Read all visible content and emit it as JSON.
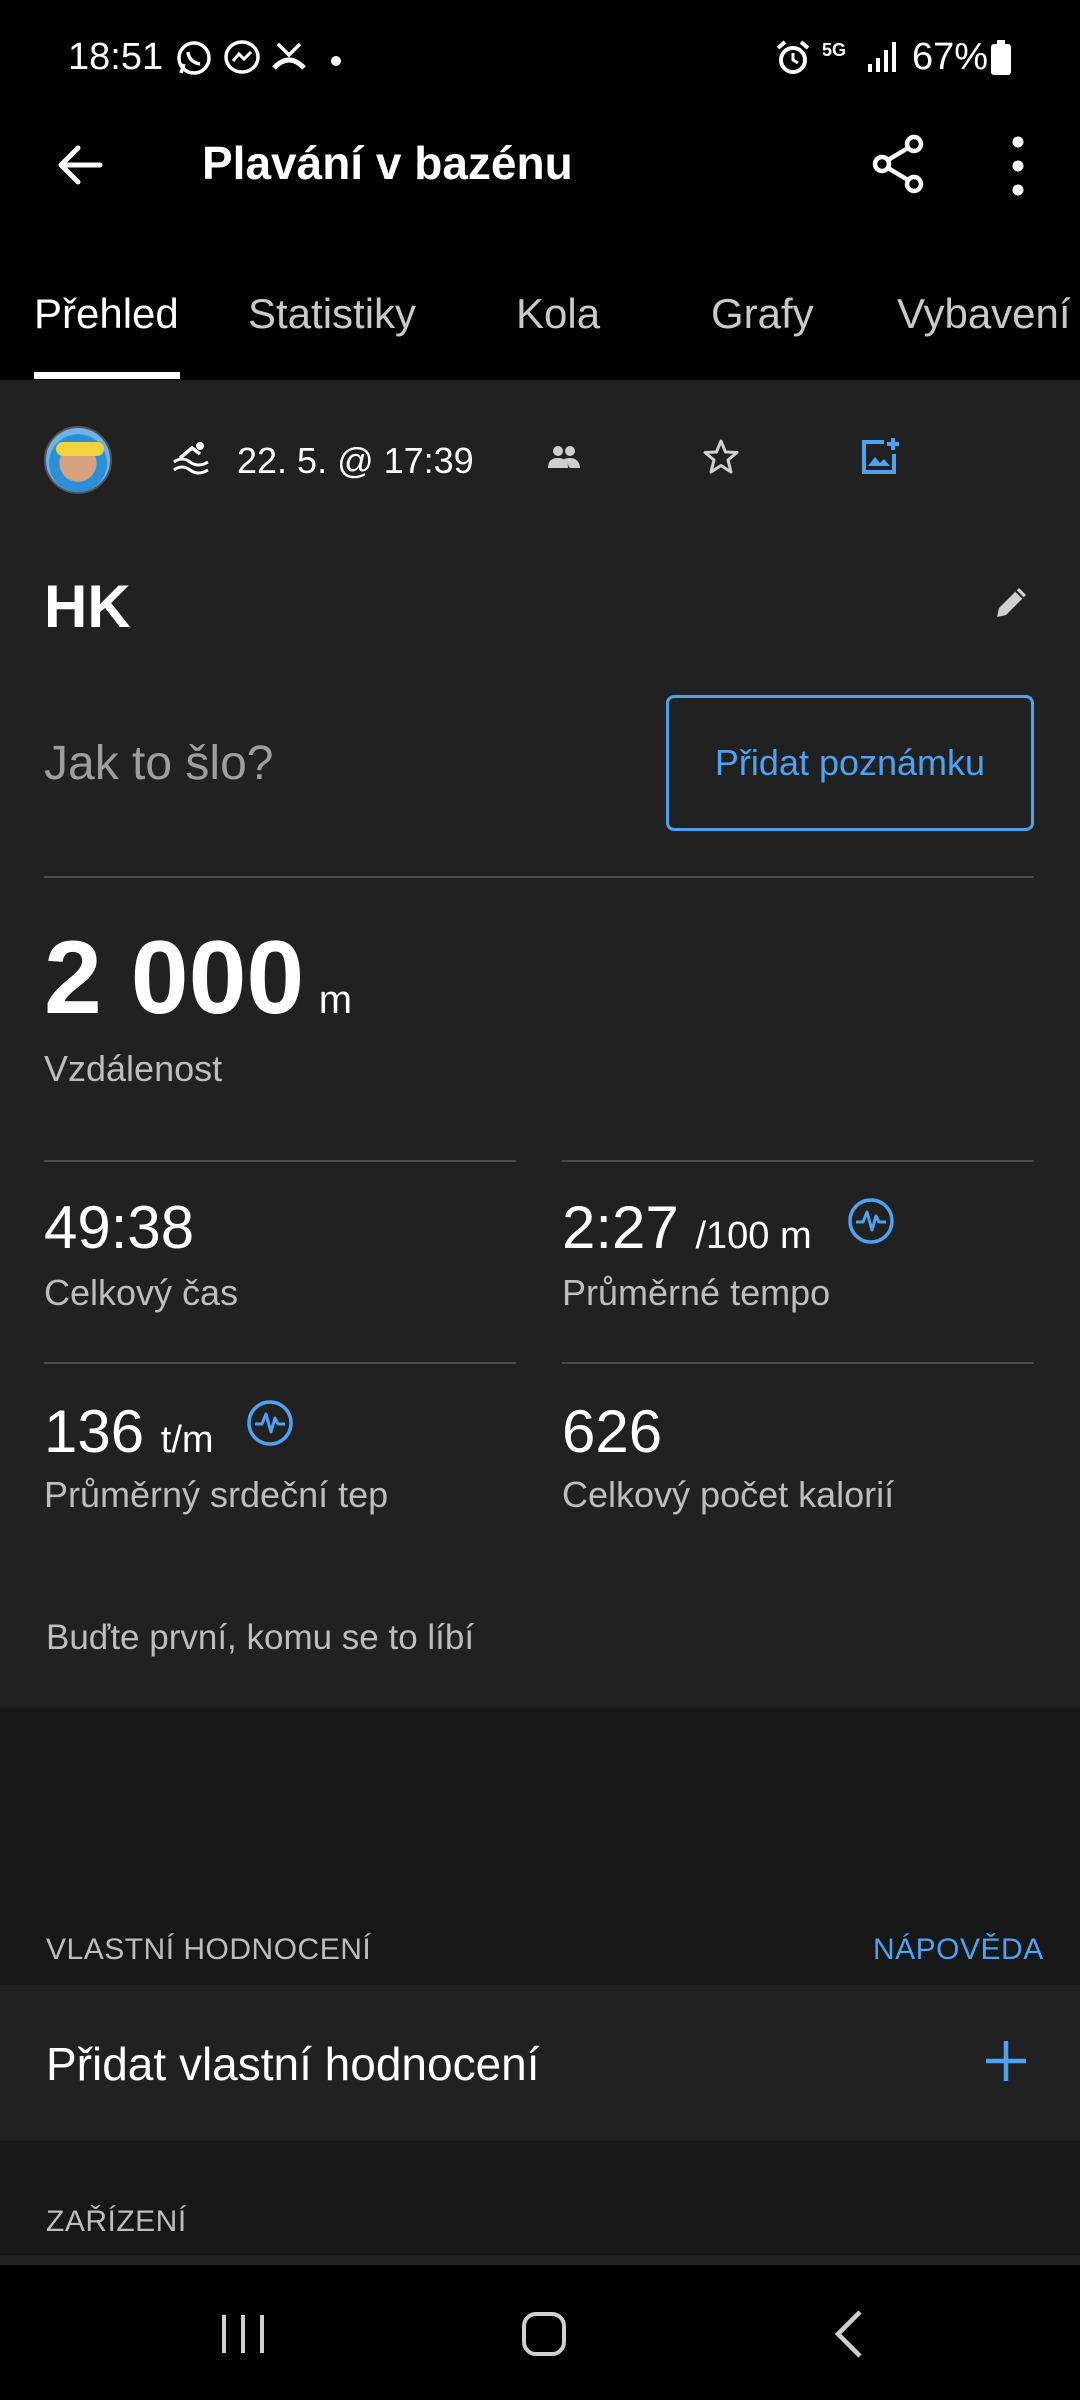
{
  "status_bar": {
    "time": "18:51",
    "battery": "67%",
    "network": "5G",
    "icons": [
      "whatsapp-icon",
      "messenger-icon",
      "missed-call-icon",
      "dot-icon",
      "alarm-icon",
      "signal-icon",
      "battery-icon"
    ]
  },
  "app_bar": {
    "title": "Plavání v bazénu",
    "icons": [
      "back-arrow-icon",
      "share-icon",
      "more-vert-icon"
    ]
  },
  "tabs": [
    {
      "label": "Přehled",
      "active": true
    },
    {
      "label": "Statistiky",
      "active": false
    },
    {
      "label": "Kola",
      "active": false
    },
    {
      "label": "Grafy",
      "active": false
    },
    {
      "label": "Vybavení",
      "active": false
    }
  ],
  "activity": {
    "date": "22. 5. @ 17:39",
    "name": "HK",
    "note_prompt": "Jak to šlo?",
    "add_note_label": "Přidat poznámku"
  },
  "distance": {
    "value": "2 000",
    "unit": "m",
    "label": "Vzdálenost"
  },
  "stats": [
    {
      "value": "49:38",
      "unit": "",
      "label": "Celkový čas"
    },
    {
      "value": "2:27",
      "unit": "/100 m",
      "label": "Průměrné tempo"
    },
    {
      "value": "136",
      "unit": "t/m",
      "label": "Průměrný srdeční tep"
    },
    {
      "value": "626",
      "unit": "",
      "label": "Celkový počet kalorií"
    }
  ],
  "likes_text": "Buďte první, komu se to líbí",
  "custom_rating": {
    "header": "VLASTNÍ HODNOCENÍ",
    "help_label": "NÁPOVĚDA",
    "add_label": "Přidat vlastní hodnocení"
  },
  "device": {
    "header": "ZAŘÍZENÍ"
  },
  "colors": {
    "accent": "#4aa3f5",
    "background": "#000000",
    "card": "#212121",
    "secondary_text": "#bdbdbd"
  }
}
